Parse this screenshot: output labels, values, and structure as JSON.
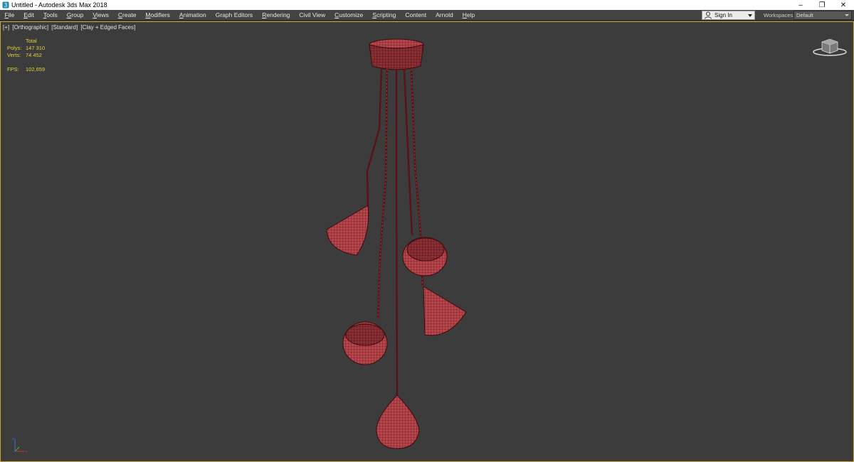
{
  "window": {
    "title": "Untitled - Autodesk 3ds Max 2018",
    "controls": [
      "minimize-icon",
      "restore-icon",
      "close-icon"
    ]
  },
  "menu": {
    "items": [
      {
        "label": "File",
        "ul": "F",
        "rest": "ile"
      },
      {
        "label": "Edit",
        "ul": "E",
        "rest": "dit"
      },
      {
        "label": "Tools",
        "ul": "T",
        "rest": "ools"
      },
      {
        "label": "Group",
        "ul": "G",
        "rest": "roup"
      },
      {
        "label": "Views",
        "ul": "V",
        "rest": "iews"
      },
      {
        "label": "Create",
        "ul": "C",
        "rest": "reate"
      },
      {
        "label": "Modifiers",
        "ul": "M",
        "rest": "odifiers"
      },
      {
        "label": "Animation",
        "ul": "A",
        "rest": "nimation"
      },
      {
        "label": "Graph Editors",
        "ul": "",
        "rest": "Graph Editors"
      },
      {
        "label": "Rendering",
        "ul": "R",
        "rest": "endering"
      },
      {
        "label": "Civil View",
        "ul": "",
        "rest": "Civil View"
      },
      {
        "label": "Customize",
        "ul": "C",
        "rest": "ustomize"
      },
      {
        "label": "Scripting",
        "ul": "S",
        "rest": "cripting"
      },
      {
        "label": "Content",
        "ul": "",
        "rest": "Content"
      },
      {
        "label": "Arnold",
        "ul": "",
        "rest": "Arnold"
      },
      {
        "label": "Help",
        "ul": "H",
        "rest": "elp"
      }
    ],
    "sign_in": "Sign In",
    "workspaces_label": "Workspaces:",
    "workspace_value": "Default"
  },
  "viewport": {
    "labels": [
      "[+]",
      "[Orthographic]",
      "[Standard]",
      "[Clay + Edged Faces]"
    ],
    "stats": {
      "header": "Total",
      "polys_label": "Polys:",
      "polys_value": "147 310",
      "verts_label": "Verts:",
      "verts_value": "74 452",
      "fps_label": "FPS:",
      "fps_value": "102,659"
    }
  },
  "colors": {
    "accent_border": "#c8a93c",
    "stats_text": "#e4d23a",
    "model_fill": "#b8474d",
    "model_wire": "#4a0f12"
  }
}
